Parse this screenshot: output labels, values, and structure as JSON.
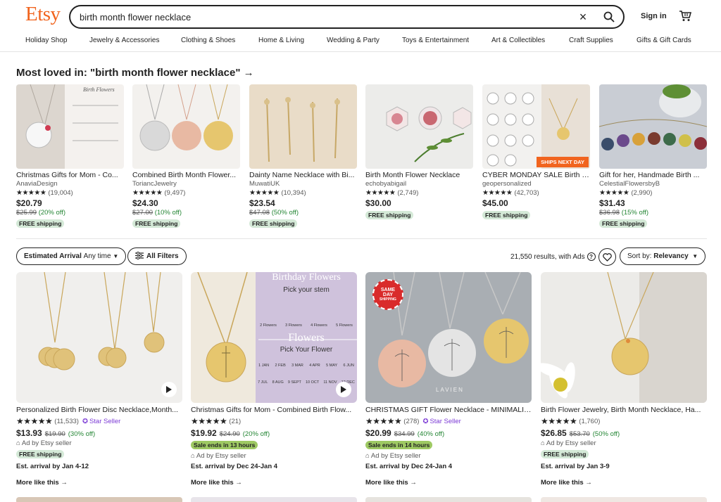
{
  "header": {
    "logo": "Etsy",
    "search_value": "birth month flower necklace",
    "sign_in": "Sign in"
  },
  "categories": [
    "Holiday Shop",
    "Jewelry & Accessories",
    "Clothing & Shoes",
    "Home & Living",
    "Wedding & Party",
    "Toys & Entertainment",
    "Art & Collectibles",
    "Craft Supplies",
    "Gifts & Gift Cards"
  ],
  "loved": {
    "title": "Most loved in: \"birth month flower necklace\"",
    "items": [
      {
        "title": "Christmas Gifts for Mom - Co...",
        "shop": "AnaviaDesign",
        "count": "(19,004)",
        "price": "$20.79",
        "orig": "$25.99",
        "off": "(20% off)",
        "ship": "FREE shipping"
      },
      {
        "title": "Combined Birth Month Flower...",
        "shop": "ToriancJewelry",
        "count": "(9,497)",
        "price": "$24.30",
        "orig": "$27.00",
        "off": "(10% off)",
        "ship": "FREE shipping"
      },
      {
        "title": "Dainty Name Necklace with Bi...",
        "shop": "MuwatiUK",
        "count": "(10,394)",
        "price": "$23.54",
        "orig": "$47.08",
        "off": "(50% off)",
        "ship": "FREE shipping"
      },
      {
        "title": "Birth Month Flower Necklace",
        "shop": "echobyabigail",
        "count": "(2,749)",
        "price": "$30.00",
        "orig": "",
        "off": "",
        "ship": "FREE shipping"
      },
      {
        "title": "CYBER MONDAY SALE Birth Fl...",
        "shop": "geopersonalized",
        "count": "(42,703)",
        "price": "$45.00",
        "orig": "",
        "off": "",
        "ship": "FREE shipping",
        "badge": "SHIPS NEXT DAY"
      },
      {
        "title": "Gift for her, Handmade Birth ...",
        "shop": "CelestialFlowersbyB",
        "count": "(2,990)",
        "price": "$31.43",
        "orig": "$36.98",
        "off": "(15% off)",
        "ship": "FREE shipping"
      }
    ]
  },
  "filters": {
    "arrival_label": "Estimated Arrival",
    "arrival_value": "Any time",
    "all_filters": "All Filters",
    "results": "21,550 results, with Ads",
    "sort_label": "Sort by:",
    "sort_value": "Relevancy"
  },
  "results": [
    {
      "title": "Personalized Birth Flower Disc Necklace,Month...",
      "count": "(11,533)",
      "star_seller": "Star Seller",
      "price": "$13.93",
      "orig": "$19.90",
      "off": "(30% off)",
      "sale": "",
      "ad": "Ad by Etsy seller",
      "ship": "FREE shipping",
      "arrival": "Est. arrival by Jan 4-12",
      "more": "More like this"
    },
    {
      "title": "Christmas Gifts for Mom - Combined Birth Flow...",
      "count": "(21)",
      "star_seller": "",
      "price": "$19.92",
      "orig": "$24.90",
      "off": "(20% off)",
      "sale": "Sale ends in 13 hours",
      "ad": "Ad by Etsy seller",
      "ship": "",
      "arrival": "Est. arrival by Dec 24-Jan 4",
      "more": "More like this"
    },
    {
      "title": "CHRISTMAS GIFT Flower Necklace - MINIMALIS...",
      "count": "(278)",
      "star_seller": "Star Seller",
      "price": "$20.99",
      "orig": "$34.99",
      "off": "(40% off)",
      "sale": "Sale ends in 14 hours",
      "ad": "Ad by Etsy seller",
      "ship": "",
      "arrival": "Est. arrival by Dec 24-Jan 4",
      "more": "More like this",
      "same_day": [
        "SAME",
        "DAY",
        "SHIPPING"
      ]
    },
    {
      "title": "Birth Flower Jewelry, Birth Month Necklace, Ha...",
      "count": "(1,760)",
      "star_seller": "",
      "price": "$26.85",
      "orig": "$53.70",
      "off": "(50% off)",
      "sale": "",
      "ad": "Ad by Etsy seller",
      "ship": "FREE shipping",
      "arrival": "Est. arrival by Jan 3-9",
      "more": "More like this"
    }
  ],
  "image_text": {
    "stem_title": "Birthday Flowers",
    "stem_sub": "Pick your stem",
    "stem_opts": [
      "2 Flowers",
      "3 Flowers",
      "4 Flowers",
      "5 Flowers"
    ],
    "flowers_title": "Flowers",
    "flowers_sub": "Pick Your Flower",
    "months": [
      "1 JAN",
      "2 FEB",
      "3 MAR",
      "4 APR",
      "5 MAY",
      "6 JUN",
      "7 JUL",
      "8 AUG",
      "9 SEPT",
      "10 OCT",
      "11 NOV",
      "12 DEC"
    ],
    "lavien": "LAVIEN"
  },
  "colors": {
    "brand": "#f1641e",
    "discount": "#258635",
    "star_seller": "#7b3ad5",
    "free_ship_bg": "#d4e9d7",
    "sale_bg": "#9ec963"
  }
}
